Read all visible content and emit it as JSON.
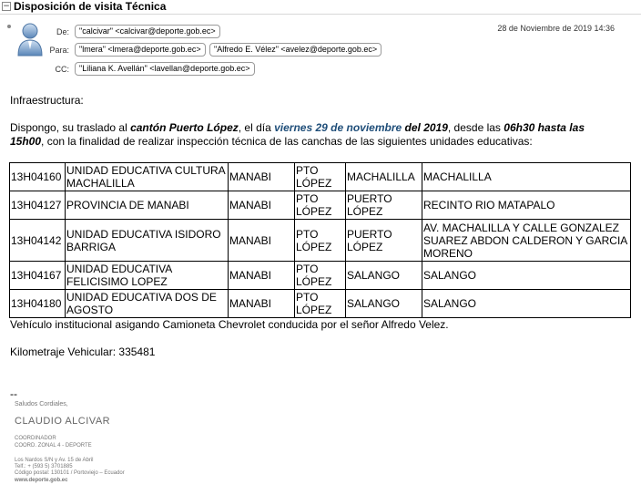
{
  "header": {
    "subject": "Disposición de visita Técnica"
  },
  "fields": {
    "de_label": "De:",
    "para_label": "Para:",
    "cc_label": "CC:",
    "from": "\"calcivar\" <calcivar@deporte.gob.ec>",
    "to": [
      "\"lmera\" <lmera@deporte.gob.ec>",
      "\"Alfredo E. Vélez\" <avelez@deporte.gob.ec>"
    ],
    "cc": "\"Liliana K. Avellán\" <lavellan@deporte.gob.ec>",
    "date": "28 de Noviembre de 2019 14:36"
  },
  "body": {
    "greeting": "Infraestructura:",
    "p1": "Dispongo,  su traslado al ",
    "p1_canton": "cantón Puerto López",
    "p1_b": ", el día ",
    "p1_day": "viernes 29 de noviembre",
    "p1_year": " del 2019",
    "p1_c": ", desde las ",
    "p1_time": "06h30 hasta las",
    "p2_time": "15h00",
    "p2": ", con la finalidad de realizar inspección técnica de las canchas de las siguientes unidades educativas:",
    "rows": [
      [
        "13H04160",
        "UNIDAD EDUCATIVA CULTURA MACHALILLA",
        "MANABI",
        "PTO LÓPEZ",
        "MACHALILLA",
        "MACHALILLA"
      ],
      [
        "13H04127",
        "PROVINCIA DE MANABI",
        "MANABI",
        "PTO LÓPEZ",
        "PUERTO LÓPEZ",
        " RECINTO RIO MATAPALO"
      ],
      [
        "13H04142",
        "UNIDAD EDUCATIVA ISIDORO BARRIGA",
        "MANABI",
        "PTO LÓPEZ",
        "PUERTO LÓPEZ",
        "AV. MACHALILLA Y CALLE GONZALEZ SUAREZ ABDON CALDERON Y GARCIA MORENO"
      ],
      [
        "13H04167",
        "UNIDAD EDUCATIVA FELICISIMO LOPEZ",
        "MANABI",
        "PTO LÓPEZ",
        "SALANGO",
        "SALANGO"
      ],
      [
        "13H04180",
        "UNIDAD EDUCATIVA DOS DE AGOSTO",
        "MANABI",
        "PTO LÓPEZ",
        "SALANGO",
        "SALANGO"
      ]
    ],
    "vehicle": "Vehículo institucional asigando Camioneta Chevrolet conducida por el señor Alfredo Velez.",
    "km": "Kilometraje Vehicular: 335481",
    "dashes": "--"
  },
  "signature": {
    "greeting": "Saludos Cordiales,",
    "name": "CLAUDIO ALCIVAR",
    "role1": "COORDINADOR",
    "role2": "COORD. ZONAL 4 - DEPORTE",
    "addr1": "Los Nardos S/N y Av. 15 de Abril",
    "addr2": "Telf.: + (593 5) 3701885",
    "addr3": "Código postal: 130101 / Portoviejo – Ecuador",
    "web": "www.deporte.gob.ec"
  }
}
